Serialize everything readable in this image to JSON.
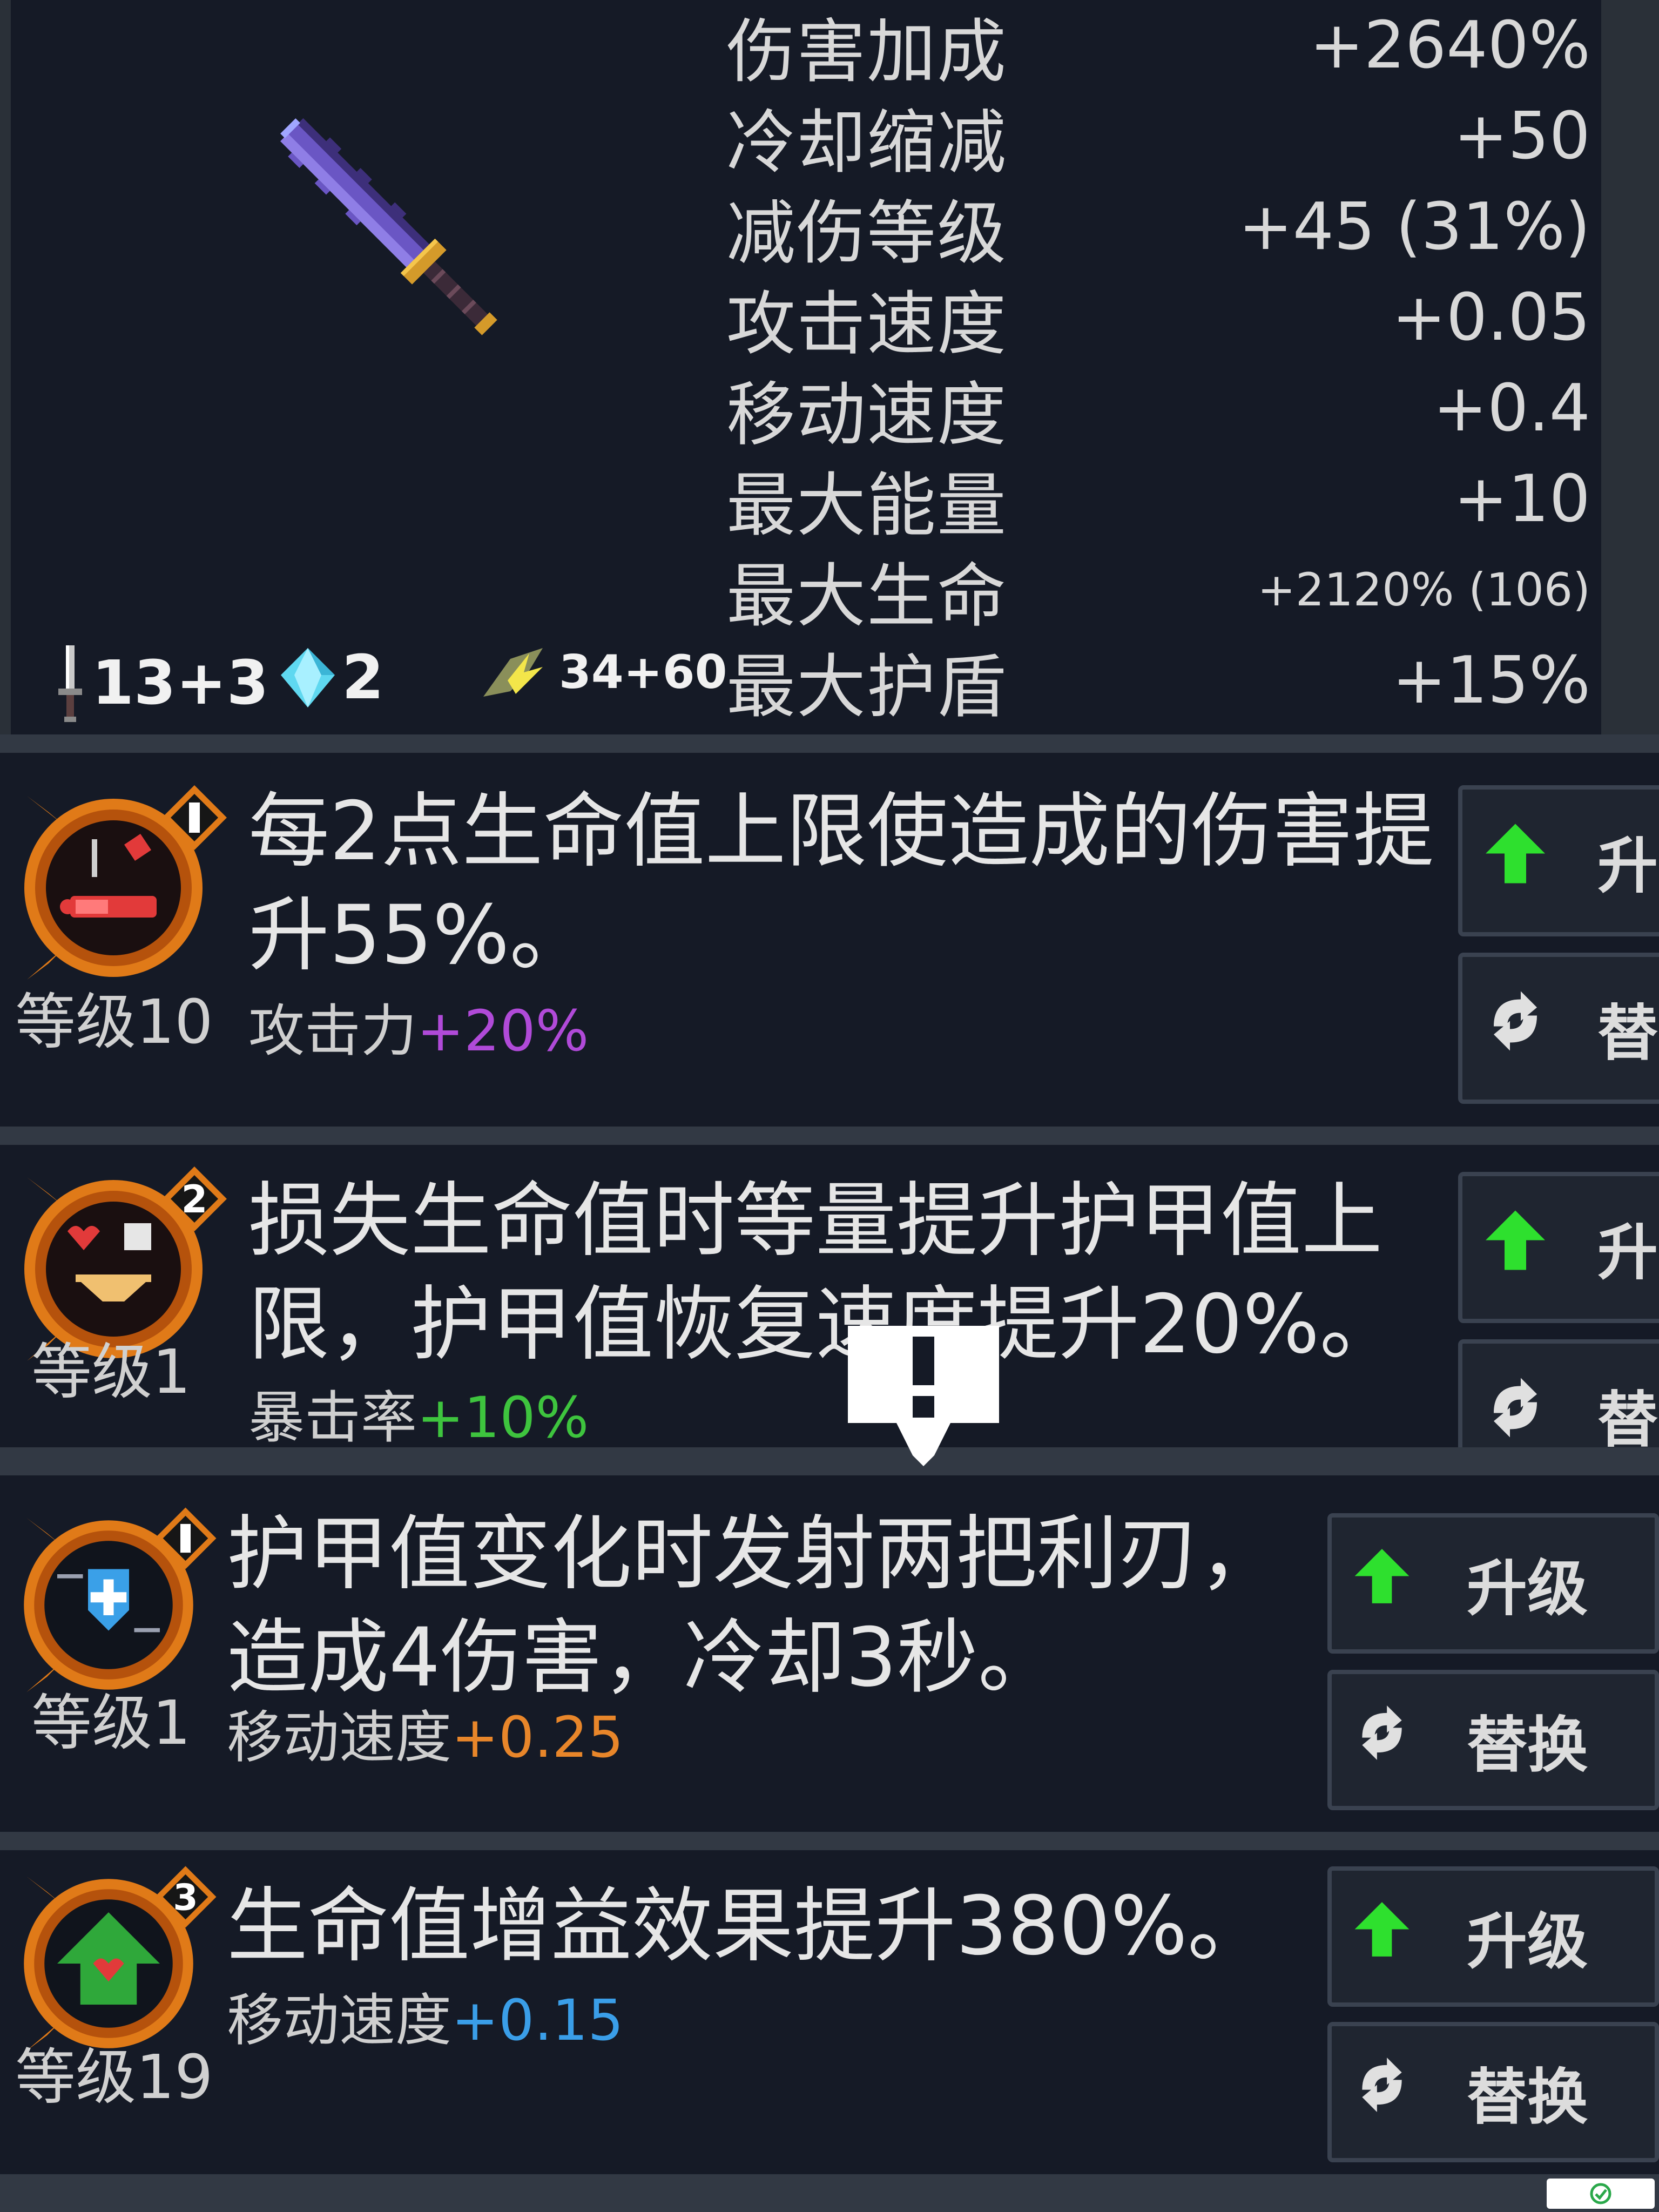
{
  "stats_panel": {
    "weapon_icon": "sword-icon",
    "resources": {
      "attack_text": "13+3",
      "gem_text": "2",
      "energy_text": "34+60"
    },
    "stats": [
      {
        "label": "伤害加成",
        "value": "+2640%"
      },
      {
        "label": "冷却缩减",
        "value": "+50"
      },
      {
        "label": "减伤等级",
        "value": "+45 (31%)"
      },
      {
        "label": "攻击速度",
        "value": "+0.05"
      },
      {
        "label": "移动速度",
        "value": "+0.4"
      },
      {
        "label": "最大能量",
        "value": "+10"
      },
      {
        "label": "最大生命",
        "value": "+2120% (106)"
      },
      {
        "label": "最大护盾",
        "value": "+15%"
      }
    ]
  },
  "perks": [
    {
      "rank": "1",
      "level": "等级10",
      "description": "每2点生命值上限使造成的伤害提升55%。",
      "bonus_label": "攻击力",
      "bonus_value": "+20%",
      "bonus_color": "#b04ad8",
      "upgrade_label": "升",
      "replace_label": "替"
    },
    {
      "rank": "2",
      "level": "等级1",
      "description": "损失生命值时等量提升护甲值上限，护甲值恢复速度提升20%。",
      "bonus_label": "暴击率",
      "bonus_value": "+10%",
      "bonus_color": "#3ec43e",
      "upgrade_label": "升",
      "replace_label": "替"
    },
    {
      "rank": "1",
      "level": "等级1",
      "description": "护甲值变化时发射两把利刃，造成4伤害，冷却3秒。",
      "bonus_label": "移动速度",
      "bonus_value": "+0.25",
      "bonus_color": "#e8862a",
      "upgrade_label": "升级",
      "replace_label": "替换"
    },
    {
      "rank": "3",
      "level": "等级19",
      "description": "生命值增益效果提升380%。",
      "bonus_label": "移动速度",
      "bonus_value": "+0.15",
      "bonus_color": "#3a9ee8",
      "upgrade_label": "升级",
      "replace_label": "替换"
    }
  ],
  "colors": {
    "panel_bg": "#151a26",
    "divider": "#323944",
    "upgrade_arrow": "#2ee02e",
    "gold_frame": "#e07a18"
  }
}
